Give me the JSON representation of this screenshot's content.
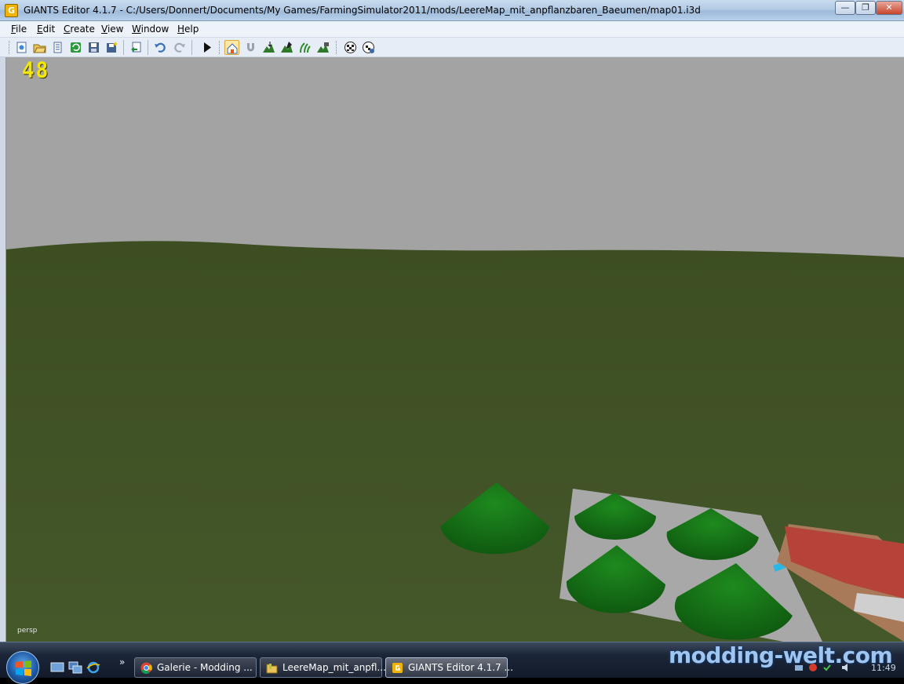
{
  "window": {
    "title": "GIANTS Editor 4.1.7 - C:/Users/Donnert/Documents/My Games/FarmingSimulator2011/mods/LeereMap_mit_anpflanzbaren_Baeumen/map01.i3d",
    "app_icon_letter": "G",
    "min_symbol": "—",
    "max_symbol": "❐",
    "close_symbol": "✕"
  },
  "menu": {
    "items": [
      {
        "key": "F",
        "rest": "ile"
      },
      {
        "key": "E",
        "rest": "dit"
      },
      {
        "key": "C",
        "rest": "reate"
      },
      {
        "key": "V",
        "rest": "iew"
      },
      {
        "key": "W",
        "rest": "indow"
      },
      {
        "key": "H",
        "rest": "elp"
      }
    ]
  },
  "toolbar": {
    "buttons": [
      "new-icon",
      "open-icon",
      "properties-icon",
      "reload-icon",
      "save-icon",
      "save-all-icon",
      "import-icon",
      "undo-icon",
      "redo-icon",
      "play-icon",
      "select-mode-icon",
      "magnet-icon",
      "terrain-sculpt-icon",
      "terrain-paint-icon",
      "foliage-paint-icon",
      "place-object-icon",
      "checker-icon",
      "checker-settings-icon"
    ]
  },
  "viewport": {
    "fps": "48",
    "camera": "persp",
    "colors": {
      "sky": "#a3a3a3",
      "ground": "#3f5222",
      "cone": "#1a7a1a",
      "slab": "#a9a9a9",
      "roof": "#b5433a",
      "wall": "#a87a5a"
    }
  },
  "taskbar": {
    "more_symbol": "»",
    "tasks": [
      {
        "label": "Galerie - Modding ...",
        "icon": "chrome-icon"
      },
      {
        "label": "LeereMap_mit_anpfl...",
        "icon": "folder-icon"
      },
      {
        "label": "GIANTS Editor 4.1.7 ...",
        "icon": "giants-editor-icon"
      }
    ],
    "watermark": "modding-welt.com",
    "clock": "11:49"
  }
}
